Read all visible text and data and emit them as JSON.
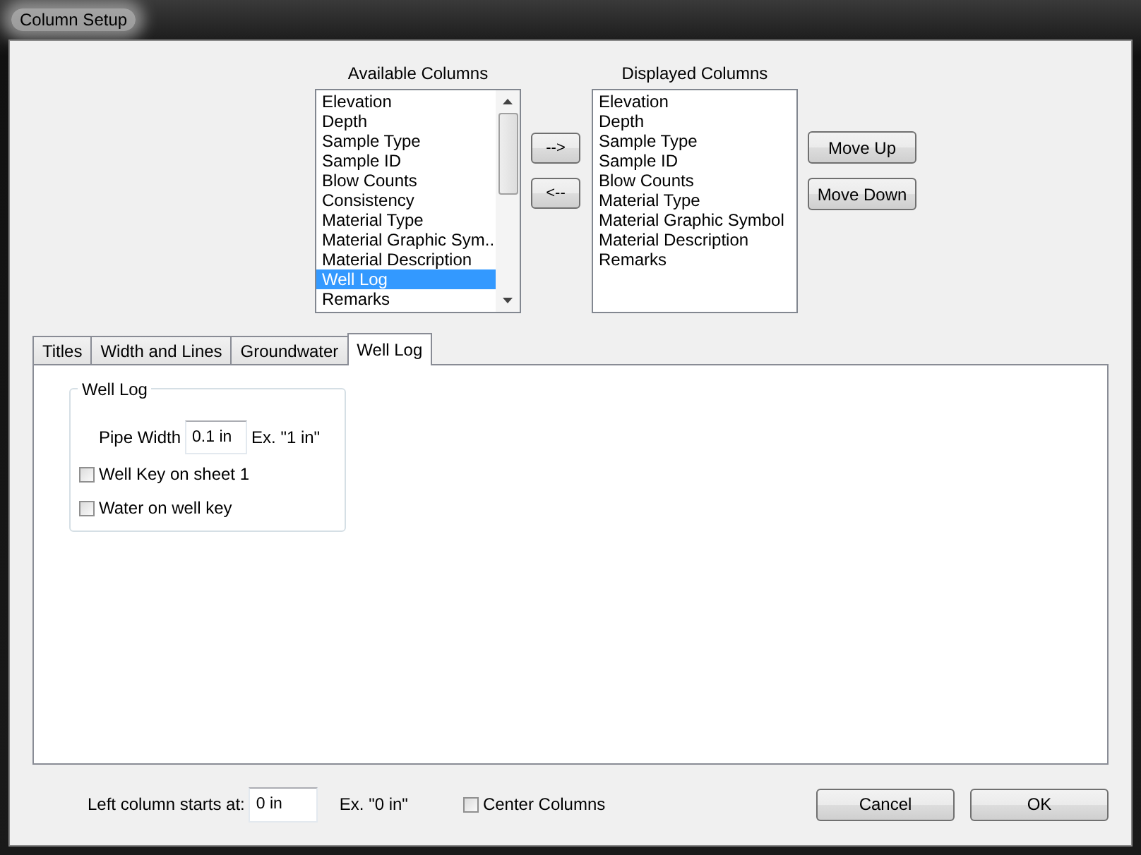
{
  "window": {
    "title": "Column Setup"
  },
  "available_columns": {
    "heading": "Available Columns",
    "items": [
      {
        "label": "Elevation",
        "selected": false
      },
      {
        "label": "Depth",
        "selected": false
      },
      {
        "label": "Sample Type",
        "selected": false
      },
      {
        "label": "Sample ID",
        "selected": false
      },
      {
        "label": "Blow Counts",
        "selected": false
      },
      {
        "label": "Consistency",
        "selected": false
      },
      {
        "label": "Material Type",
        "selected": false
      },
      {
        "label": "Material Graphic Sym...",
        "selected": false
      },
      {
        "label": "Material Description",
        "selected": false
      },
      {
        "label": "Well Log",
        "selected": true
      },
      {
        "label": "Remarks",
        "selected": false
      }
    ]
  },
  "transfer_buttons": [
    "-->",
    "<--"
  ],
  "displayed_columns": {
    "heading": "Displayed Columns",
    "items": [
      {
        "label": "Elevation",
        "selected": false
      },
      {
        "label": "Depth",
        "selected": false
      },
      {
        "label": "Sample Type",
        "selected": false
      },
      {
        "label": "Sample ID",
        "selected": false
      },
      {
        "label": "Blow Counts",
        "selected": false
      },
      {
        "label": "Material Type",
        "selected": false
      },
      {
        "label": "Material Graphic Symbol",
        "selected": false
      },
      {
        "label": "Material Description",
        "selected": false
      },
      {
        "label": "Remarks",
        "selected": false
      }
    ]
  },
  "order_buttons": [
    "Move Up",
    "Move Down"
  ],
  "tabs": [
    {
      "label": "Titles",
      "selected": false
    },
    {
      "label": "Width and Lines",
      "selected": false
    },
    {
      "label": "Groundwater",
      "selected": false
    },
    {
      "label": "Well Log",
      "selected": true
    }
  ],
  "well_log_group": {
    "title": "Well Log",
    "pipe_width": {
      "label": "Pipe Width",
      "value": "0.1 in",
      "hint": "Ex. \"1 in\""
    },
    "checkboxes": [
      {
        "label": "Well Key on sheet 1",
        "checked": false
      },
      {
        "label": "Water on well key",
        "checked": false
      }
    ]
  },
  "left_column": {
    "label": "Left column starts at:",
    "value": "0 in",
    "hint": "Ex. \"0 in\""
  },
  "center_columns": {
    "label": "Center Columns",
    "checked": false
  },
  "buttons": [
    "Cancel",
    "OK"
  ]
}
